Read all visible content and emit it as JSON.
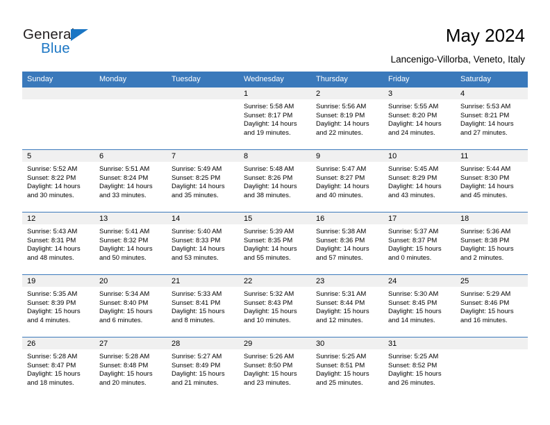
{
  "brand": {
    "name_top": "General",
    "name_bottom": "Blue",
    "triangle_icon": "triangle-icon",
    "color_primary": "#1b76c4",
    "color_text": "#231f20"
  },
  "header": {
    "title": "May 2024",
    "subtitle": "Lancenigo-Villorba, Veneto, Italy"
  },
  "theme": {
    "header_blue": "#3a79bb",
    "band_gray": "#f0f0f0",
    "text": "#000000"
  },
  "weekday_headers": [
    "Sunday",
    "Monday",
    "Tuesday",
    "Wednesday",
    "Thursday",
    "Friday",
    "Saturday"
  ],
  "weeks": [
    [
      {
        "day": "",
        "sunrise": "",
        "sunset": "",
        "daylight1": "",
        "daylight2": ""
      },
      {
        "day": "",
        "sunrise": "",
        "sunset": "",
        "daylight1": "",
        "daylight2": ""
      },
      {
        "day": "",
        "sunrise": "",
        "sunset": "",
        "daylight1": "",
        "daylight2": ""
      },
      {
        "day": "1",
        "sunrise": "Sunrise: 5:58 AM",
        "sunset": "Sunset: 8:17 PM",
        "daylight1": "Daylight: 14 hours",
        "daylight2": "and 19 minutes."
      },
      {
        "day": "2",
        "sunrise": "Sunrise: 5:56 AM",
        "sunset": "Sunset: 8:19 PM",
        "daylight1": "Daylight: 14 hours",
        "daylight2": "and 22 minutes."
      },
      {
        "day": "3",
        "sunrise": "Sunrise: 5:55 AM",
        "sunset": "Sunset: 8:20 PM",
        "daylight1": "Daylight: 14 hours",
        "daylight2": "and 24 minutes."
      },
      {
        "day": "4",
        "sunrise": "Sunrise: 5:53 AM",
        "sunset": "Sunset: 8:21 PM",
        "daylight1": "Daylight: 14 hours",
        "daylight2": "and 27 minutes."
      }
    ],
    [
      {
        "day": "5",
        "sunrise": "Sunrise: 5:52 AM",
        "sunset": "Sunset: 8:22 PM",
        "daylight1": "Daylight: 14 hours",
        "daylight2": "and 30 minutes."
      },
      {
        "day": "6",
        "sunrise": "Sunrise: 5:51 AM",
        "sunset": "Sunset: 8:24 PM",
        "daylight1": "Daylight: 14 hours",
        "daylight2": "and 33 minutes."
      },
      {
        "day": "7",
        "sunrise": "Sunrise: 5:49 AM",
        "sunset": "Sunset: 8:25 PM",
        "daylight1": "Daylight: 14 hours",
        "daylight2": "and 35 minutes."
      },
      {
        "day": "8",
        "sunrise": "Sunrise: 5:48 AM",
        "sunset": "Sunset: 8:26 PM",
        "daylight1": "Daylight: 14 hours",
        "daylight2": "and 38 minutes."
      },
      {
        "day": "9",
        "sunrise": "Sunrise: 5:47 AM",
        "sunset": "Sunset: 8:27 PM",
        "daylight1": "Daylight: 14 hours",
        "daylight2": "and 40 minutes."
      },
      {
        "day": "10",
        "sunrise": "Sunrise: 5:45 AM",
        "sunset": "Sunset: 8:29 PM",
        "daylight1": "Daylight: 14 hours",
        "daylight2": "and 43 minutes."
      },
      {
        "day": "11",
        "sunrise": "Sunrise: 5:44 AM",
        "sunset": "Sunset: 8:30 PM",
        "daylight1": "Daylight: 14 hours",
        "daylight2": "and 45 minutes."
      }
    ],
    [
      {
        "day": "12",
        "sunrise": "Sunrise: 5:43 AM",
        "sunset": "Sunset: 8:31 PM",
        "daylight1": "Daylight: 14 hours",
        "daylight2": "and 48 minutes."
      },
      {
        "day": "13",
        "sunrise": "Sunrise: 5:41 AM",
        "sunset": "Sunset: 8:32 PM",
        "daylight1": "Daylight: 14 hours",
        "daylight2": "and 50 minutes."
      },
      {
        "day": "14",
        "sunrise": "Sunrise: 5:40 AM",
        "sunset": "Sunset: 8:33 PM",
        "daylight1": "Daylight: 14 hours",
        "daylight2": "and 53 minutes."
      },
      {
        "day": "15",
        "sunrise": "Sunrise: 5:39 AM",
        "sunset": "Sunset: 8:35 PM",
        "daylight1": "Daylight: 14 hours",
        "daylight2": "and 55 minutes."
      },
      {
        "day": "16",
        "sunrise": "Sunrise: 5:38 AM",
        "sunset": "Sunset: 8:36 PM",
        "daylight1": "Daylight: 14 hours",
        "daylight2": "and 57 minutes."
      },
      {
        "day": "17",
        "sunrise": "Sunrise: 5:37 AM",
        "sunset": "Sunset: 8:37 PM",
        "daylight1": "Daylight: 15 hours",
        "daylight2": "and 0 minutes."
      },
      {
        "day": "18",
        "sunrise": "Sunrise: 5:36 AM",
        "sunset": "Sunset: 8:38 PM",
        "daylight1": "Daylight: 15 hours",
        "daylight2": "and 2 minutes."
      }
    ],
    [
      {
        "day": "19",
        "sunrise": "Sunrise: 5:35 AM",
        "sunset": "Sunset: 8:39 PM",
        "daylight1": "Daylight: 15 hours",
        "daylight2": "and 4 minutes."
      },
      {
        "day": "20",
        "sunrise": "Sunrise: 5:34 AM",
        "sunset": "Sunset: 8:40 PM",
        "daylight1": "Daylight: 15 hours",
        "daylight2": "and 6 minutes."
      },
      {
        "day": "21",
        "sunrise": "Sunrise: 5:33 AM",
        "sunset": "Sunset: 8:41 PM",
        "daylight1": "Daylight: 15 hours",
        "daylight2": "and 8 minutes."
      },
      {
        "day": "22",
        "sunrise": "Sunrise: 5:32 AM",
        "sunset": "Sunset: 8:43 PM",
        "daylight1": "Daylight: 15 hours",
        "daylight2": "and 10 minutes."
      },
      {
        "day": "23",
        "sunrise": "Sunrise: 5:31 AM",
        "sunset": "Sunset: 8:44 PM",
        "daylight1": "Daylight: 15 hours",
        "daylight2": "and 12 minutes."
      },
      {
        "day": "24",
        "sunrise": "Sunrise: 5:30 AM",
        "sunset": "Sunset: 8:45 PM",
        "daylight1": "Daylight: 15 hours",
        "daylight2": "and 14 minutes."
      },
      {
        "day": "25",
        "sunrise": "Sunrise: 5:29 AM",
        "sunset": "Sunset: 8:46 PM",
        "daylight1": "Daylight: 15 hours",
        "daylight2": "and 16 minutes."
      }
    ],
    [
      {
        "day": "26",
        "sunrise": "Sunrise: 5:28 AM",
        "sunset": "Sunset: 8:47 PM",
        "daylight1": "Daylight: 15 hours",
        "daylight2": "and 18 minutes."
      },
      {
        "day": "27",
        "sunrise": "Sunrise: 5:28 AM",
        "sunset": "Sunset: 8:48 PM",
        "daylight1": "Daylight: 15 hours",
        "daylight2": "and 20 minutes."
      },
      {
        "day": "28",
        "sunrise": "Sunrise: 5:27 AM",
        "sunset": "Sunset: 8:49 PM",
        "daylight1": "Daylight: 15 hours",
        "daylight2": "and 21 minutes."
      },
      {
        "day": "29",
        "sunrise": "Sunrise: 5:26 AM",
        "sunset": "Sunset: 8:50 PM",
        "daylight1": "Daylight: 15 hours",
        "daylight2": "and 23 minutes."
      },
      {
        "day": "30",
        "sunrise": "Sunrise: 5:25 AM",
        "sunset": "Sunset: 8:51 PM",
        "daylight1": "Daylight: 15 hours",
        "daylight2": "and 25 minutes."
      },
      {
        "day": "31",
        "sunrise": "Sunrise: 5:25 AM",
        "sunset": "Sunset: 8:52 PM",
        "daylight1": "Daylight: 15 hours",
        "daylight2": "and 26 minutes."
      },
      {
        "day": "",
        "sunrise": "",
        "sunset": "",
        "daylight1": "",
        "daylight2": ""
      }
    ]
  ]
}
